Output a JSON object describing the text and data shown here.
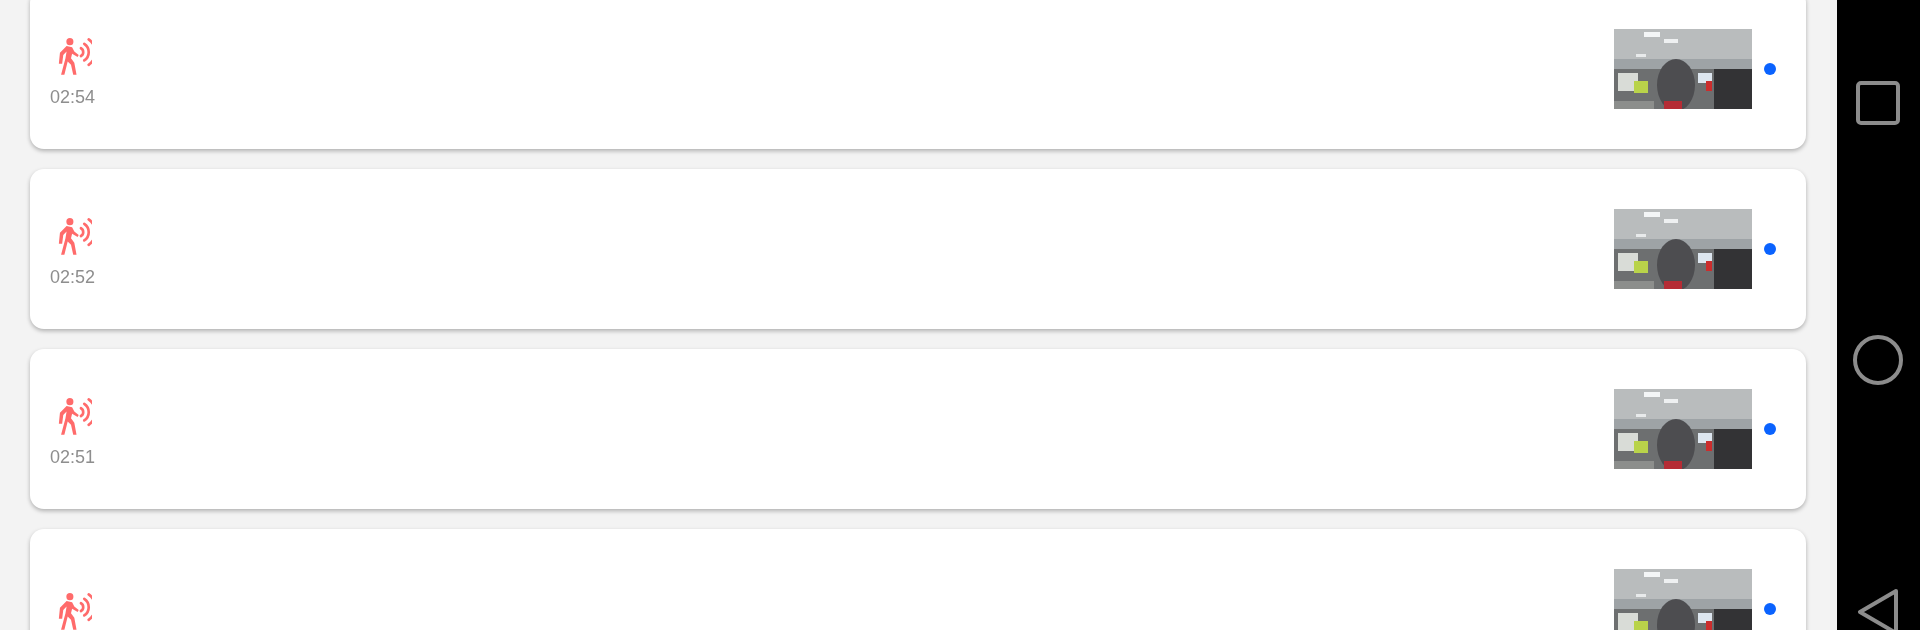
{
  "events": [
    {
      "kind": "motion",
      "time": "02:54",
      "unread": true
    },
    {
      "kind": "motion",
      "time": "02:52",
      "unread": true
    },
    {
      "kind": "motion",
      "time": "02:51",
      "unread": true
    },
    {
      "kind": "motion",
      "unread": true
    }
  ]
}
